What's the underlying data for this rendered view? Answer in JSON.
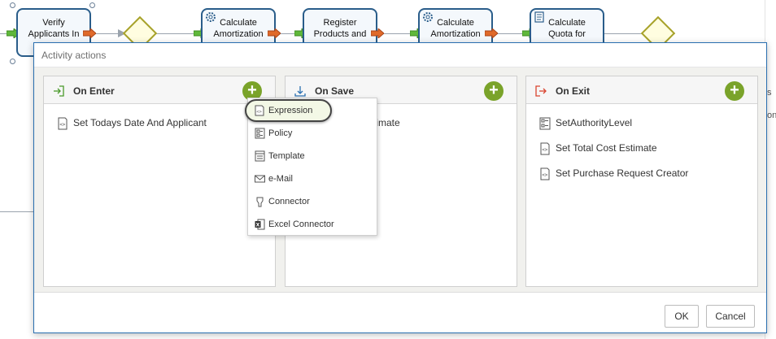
{
  "diagram": {
    "tasks": [
      {
        "label": "Verify Applicants In"
      },
      {
        "label": "Calculate Amortization"
      },
      {
        "label": "Register Products and"
      },
      {
        "label": "Calculate Amortization"
      },
      {
        "label": "Calculate Quota for"
      }
    ],
    "right_text": [
      "s",
      "ons"
    ]
  },
  "dialog": {
    "title": "Activity actions",
    "panels": [
      {
        "title": "On Enter",
        "icon": "enter-arrow-icon",
        "items": [
          {
            "label": "Set Todays Date And Applicant",
            "icon": "expression-icon"
          }
        ]
      },
      {
        "title": "On Save",
        "icon": "save-down-arrow-icon",
        "items": [
          {
            "label": "stimate",
            "icon": "expression-icon"
          }
        ]
      },
      {
        "title": "On Exit",
        "icon": "exit-arrow-icon",
        "items": [
          {
            "label": "SetAuthorityLevel",
            "icon": "policy-icon"
          },
          {
            "label": "Set Total Cost Estimate",
            "icon": "expression-icon"
          },
          {
            "label": "Set Purchase Request Creator",
            "icon": "expression-icon"
          }
        ]
      }
    ],
    "add_label": "+",
    "ok_label": "OK",
    "cancel_label": "Cancel"
  },
  "add_menu": {
    "items": [
      {
        "label": "Expression",
        "icon": "expression-icon",
        "highlighted": true
      },
      {
        "label": "Policy",
        "icon": "policy-icon"
      },
      {
        "label": "Template",
        "icon": "template-icon"
      },
      {
        "label": "e-Mail",
        "icon": "email-icon"
      },
      {
        "label": "Connector",
        "icon": "connector-icon"
      },
      {
        "label": "Excel Connector",
        "icon": "excel-icon"
      }
    ]
  },
  "colors": {
    "accent_blue": "#2a6fb0",
    "add_green": "#7aa32a",
    "task_border": "#2a5d8a",
    "gateway": "#a7a22a"
  }
}
